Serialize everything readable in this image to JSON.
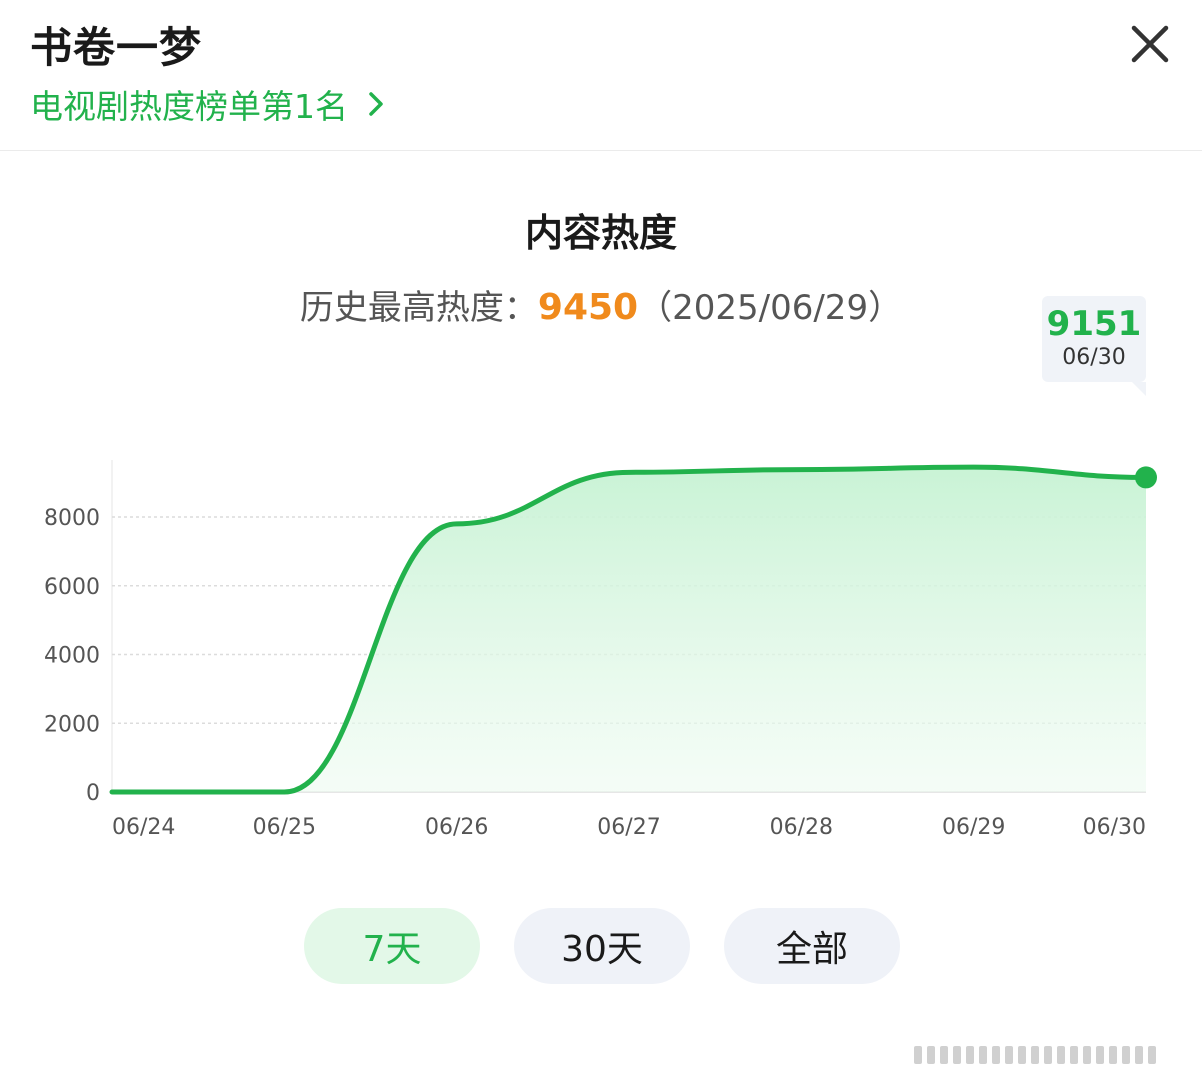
{
  "header": {
    "title": "书卷一梦",
    "rank_link": "电视剧热度榜单第1名",
    "chevron_icon": "chevron-right-icon",
    "close_icon": "close-icon"
  },
  "summary": {
    "chart_title": "内容热度",
    "peak_label": "历史最高热度：",
    "peak_value": "9450",
    "peak_date": "（2025/06/29）"
  },
  "tooltip": {
    "value": "9151",
    "date": "06/30"
  },
  "colors": {
    "accent": "#22b24c",
    "peak": "#f08a1c",
    "button_bg": "#eff2f8",
    "button_active_bg": "#e3f8e8"
  },
  "range_buttons": [
    {
      "label": "7天",
      "active": true
    },
    {
      "label": "30天",
      "active": false
    },
    {
      "label": "全部",
      "active": false
    }
  ],
  "chart_data": {
    "type": "area",
    "categories": [
      "06/24",
      "06/25",
      "06/26",
      "06/27",
      "06/28",
      "06/29",
      "06/30"
    ],
    "series": [
      {
        "values": [
          0,
          0,
          7800,
          9300,
          9380,
          9450,
          9151
        ]
      }
    ],
    "ylim": [
      0,
      9500
    ],
    "yticks": [
      0,
      2000,
      4000,
      6000,
      8000
    ],
    "grid": true,
    "highlight_last_point": true
  }
}
